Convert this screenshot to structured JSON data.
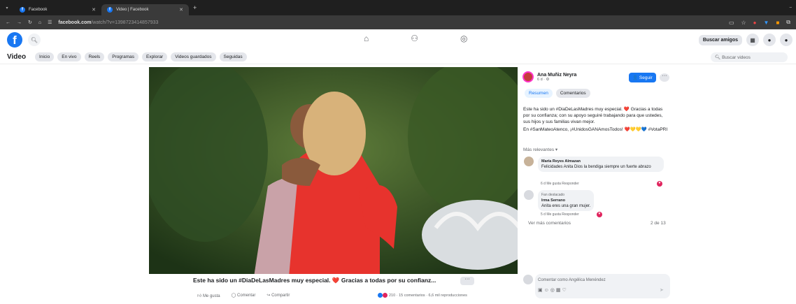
{
  "browser": {
    "tabs": [
      {
        "label": "Facebook"
      },
      {
        "label": "Video | Facebook"
      }
    ],
    "url": "facebook.com",
    "url_path": "/watch/?v=1398723414857933"
  },
  "fb": {
    "friends_button": "Buscar amigos"
  },
  "video_nav": {
    "title": "Video",
    "chips": [
      "Inicio",
      "En vivo",
      "Reels",
      "Programas",
      "Explorar",
      "Videos guardados",
      "Seguidas"
    ],
    "search_placeholder": "Buscar videos"
  },
  "post": {
    "caption": "Este ha sido un #DiaDeLasMadres muy especial. ❤️ Gracias a todas por su confianz...",
    "actions": {
      "like": "Me gusta",
      "comment": "Comentar",
      "share": "Compartir"
    },
    "stats": "210 · 15 comentarios · 6,6 mil reproducciones"
  },
  "side": {
    "author": "Ana Muñiz Neyra",
    "time": "6 d · ⚙",
    "follow": "Seguir",
    "tabs": [
      "Resumen",
      "Comentarios"
    ],
    "body": "Este ha sido un #DiaDeLasMadres muy especial. ❤️ Gracias a todas por su confianza; con su apoyo seguiré trabajando para que ustedes, sus hijos y sus familias vivan mejor.",
    "body2": "En #SanMateoAtenco, ¡#UnidosGANAmosTodos! ❤️💛💛💙 #VotaPRI",
    "relevant": "Más relevantes ▾",
    "comments": [
      {
        "name": "María Reyes Almazan",
        "text": "Felicidades Anita Dios la bendiga siempre un fuerte abrazo",
        "meta": "6 d    Me gusta    Responder"
      },
      {
        "tag": "Fan destacado",
        "name": "Irma Serrano",
        "text": "Anita eres una gran mujer.",
        "meta": "5 d    Me gusta    Responder"
      }
    ],
    "more": "Ver más comentarios",
    "count": "2 de 13",
    "comment_placeholder": "Comentar como Angélica Menéndez"
  }
}
